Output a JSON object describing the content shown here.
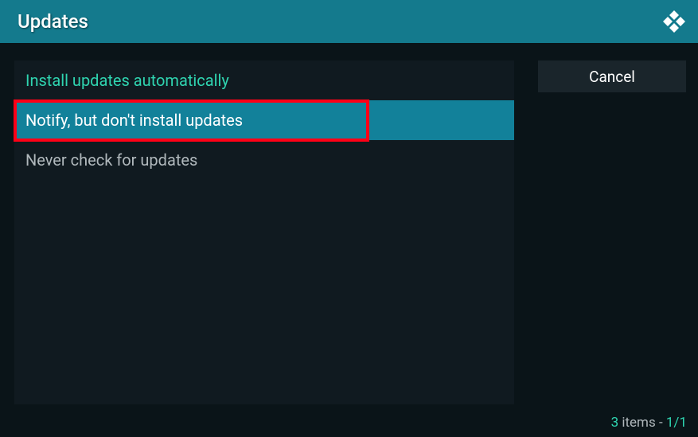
{
  "title": "Updates",
  "options": [
    {
      "label": "Install updates automatically",
      "current": true,
      "selected": false
    },
    {
      "label": "Notify, but don't install updates",
      "current": false,
      "selected": true
    },
    {
      "label": "Never check for updates",
      "current": false,
      "selected": false
    }
  ],
  "buttons": {
    "cancel": "Cancel"
  },
  "footer": {
    "count": "3",
    "items_label": " items ",
    "separator": "- ",
    "page": "1/1"
  },
  "colors": {
    "accent": "#147a8d",
    "highlight": "#2fd4b0",
    "annotation": "#ff0016",
    "panel": "#101a20",
    "background": "#0a1418"
  }
}
